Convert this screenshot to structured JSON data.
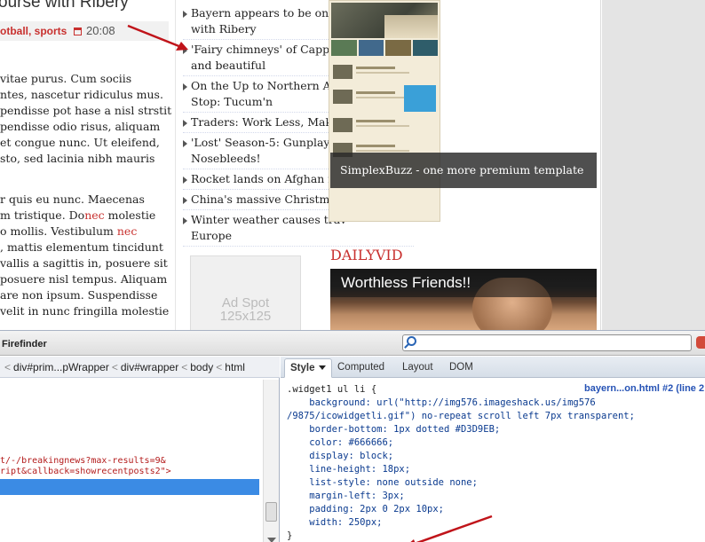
{
  "post": {
    "title": "ourse with Ribery",
    "tag1": "otball",
    "sep": ", ",
    "tag2": "sports",
    "time": "20:08",
    "para1_a": "vitae purus. Cum sociis\nntes, nascetur ridiculus mus.\npendisse pot hase a nisl strstit\npendisse odio risus, aliquam\net congue nunc. Ut eleifend,\nsto, sed lacinia nibh mauris",
    "para2_a": "r quis eu nunc. Maecenas\nm tristique. Do",
    "para2_red1": "nec",
    "para2_b": " molestie\no mollis. Vestibulum ",
    "para2_red2": "nec",
    "para2_c": "\n, mattis elementum tincidunt\nvallis a sagittis in, posuere sit\nposuere nisl tempus. Aliquam\nare non ipsum. Suspendisse\nvelit in nunc fringilla molestie"
  },
  "news": [
    "Bayern appears to be on col\nwith Ribery",
    "'Fairy chimneys' of Cappad\nand beautiful",
    "On the Up to Northern Arge\nStop: Tucum'n",
    "Traders: Work Less, Make M",
    "'Lost' Season-5: Gunplay! H\nNosebleeds!",
    "Rocket lands on Afghan mi",
    "China's massive Christmas",
    "Winter weather causes trav\nEurope"
  ],
  "ad": {
    "line1": "Ad Spot",
    "line2": "125x125"
  },
  "template_caption": "SimplexBuzz - one more premium template",
  "dailyvid": {
    "heading": "DAILYVID",
    "video_title": "Worthless Friends!!"
  },
  "firebug": {
    "title": "Firefinder",
    "breadcrumb": [
      "div#prim...pWrapper",
      "div#wrapper",
      "body",
      "html"
    ],
    "code_line1": "t/-/breakingnews?max-results=9&",
    "code_line2": "ript&callback=showrecentposts2\">",
    "tabs": [
      "Style",
      "Computed",
      "Layout",
      "DOM"
    ],
    "css_source": "bayern...on.html #2 (line 2",
    "css_selector": ".widget1 ul li {",
    "css_lines": [
      "    background: url(\"http://img576.imageshack.us/img576",
      "/9875/icowidgetli.gif\") no-repeat scroll left 7px transparent;",
      "    border-bottom: 1px dotted #D3D9EB;",
      "    color: #666666;",
      "    display: block;",
      "    line-height: 18px;",
      "    list-style: none outside none;",
      "    margin-left: 3px;",
      "    padding: 2px 0 2px 10px;",
      "    width: 250px;"
    ],
    "css_close": "}"
  },
  "colors": {
    "accent_red": "#c8302e",
    "firebug_highlight": "#3b8be4",
    "arrow": "#c0141a"
  }
}
